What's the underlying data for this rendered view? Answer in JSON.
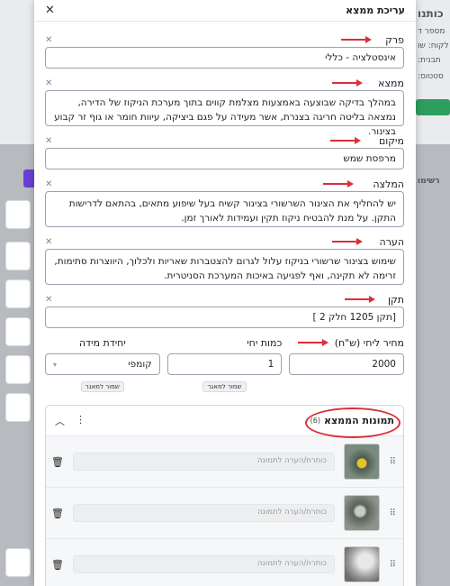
{
  "modal": {
    "title": "עריכת ממצא",
    "close_icon": "close-icon"
  },
  "fields": [
    {
      "key": "chapter",
      "label": "פרק",
      "value": "אינסטלציה - כללי"
    },
    {
      "key": "finding",
      "label": "ממצא",
      "value": "במהלך בדיקה שבוצעה באמצעות מצלמת קווים בתוך מערכת הניקוז של הדירה, נמצאה בליטה חריגה בצנרת, אשר מעידה על פגם ביציקה, עיוות חומר או גוף זר קבוע בצינור."
    },
    {
      "key": "location",
      "label": "מיקום",
      "value": "מרפסת שמש"
    },
    {
      "key": "recommendation",
      "label": "המלצה",
      "value": "יש להחליף את הצינור השרשורי בצינור קשיח בעל שיפוע מתאים, בהתאם לדרישות התקן. על מנת להבטיח ניקוז תקין ועמידות לאורך זמן."
    },
    {
      "key": "note",
      "label": "הערה",
      "value": "שימוש בצינור שרשורי בניקוז עלול לגרום להצטברות שאריות ולכלוך, היווצרות סתימות, זרימה לא תקינה, ואף לפגיעה באיכות המערכת הסניטרית."
    },
    {
      "key": "standard",
      "label": "תקן",
      "value": "[תקן 1205 חלק 2 ]"
    }
  ],
  "pricing": {
    "unit_price_label": "מחיר ליחי (ש\"ח)",
    "unit_price_value": "2000",
    "quantity_label": "כמות יחי",
    "quantity_value": "1",
    "quantity_save": "שמור למאגר",
    "unit_label": "יחידת מידה",
    "unit_value": "קומפי",
    "unit_save": "שמור למאגר"
  },
  "photos": {
    "title": "תמונות הממצא",
    "count": "(6)",
    "caption_placeholder": "כותרת/הערה לתמונה",
    "items": [
      {
        "thumb": "pipe-drain-photo"
      },
      {
        "thumb": "pipe-interior-photo"
      },
      {
        "thumb": "pipe-blur-photo"
      }
    ]
  },
  "colors": {
    "annotation_red": "#d9303a",
    "accent_green": "#2e9e5e",
    "accent_purple": "#6b3fd6"
  },
  "background": {
    "left_labels": [
      "כותנו",
      "מספר ד",
      "לקוח: שו",
      "תבנית:",
      "סטטוס:"
    ],
    "list_title": "רשימו"
  }
}
